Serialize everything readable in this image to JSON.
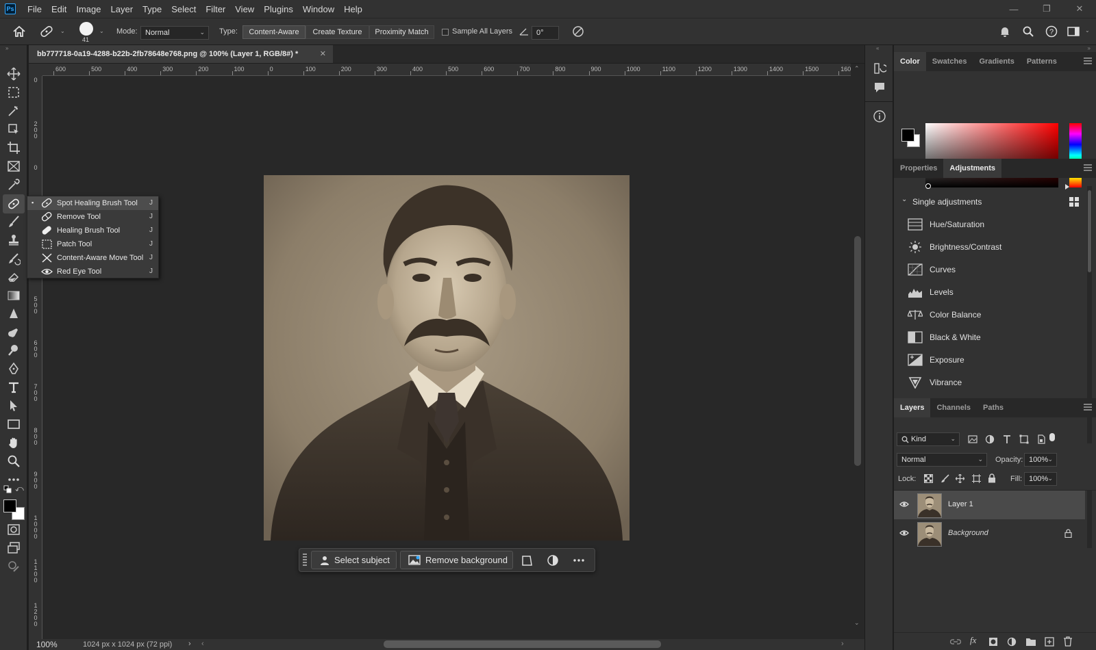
{
  "app": {
    "logo": "Ps"
  },
  "menu": [
    "File",
    "Edit",
    "Image",
    "Layer",
    "Type",
    "Select",
    "Filter",
    "View",
    "Plugins",
    "Window",
    "Help"
  ],
  "window_controls": [
    "—",
    "❐",
    "✕"
  ],
  "options": {
    "brush_size": "41",
    "mode_label": "Mode:",
    "mode_value": "Normal",
    "type_label": "Type:",
    "type_buttons": [
      "Content-Aware",
      "Create Texture",
      "Proximity Match"
    ],
    "sample_all_layers": "Sample All Layers",
    "angle_value": "0°"
  },
  "document": {
    "tab_title": "bb777718-0a19-4288-b22b-2fb78648e768.png @ 100% (Layer 1, RGB/8#) *",
    "zoom": "100%",
    "dimensions": "1024 px x 1024 px (72 ppi)"
  },
  "ruler": {
    "h_labels": [
      "600",
      "500",
      "400",
      "300",
      "200",
      "100",
      "0",
      "100",
      "200",
      "300",
      "400",
      "500",
      "600",
      "700",
      "800",
      "900",
      "1000",
      "1100",
      "1200",
      "1300",
      "1400",
      "1500",
      "1600"
    ],
    "v_labels": [
      "0",
      "2 0 0",
      "0",
      "3 0 0",
      "4 0 0",
      "5 0 0",
      "6 0 0",
      "7 0 0",
      "8 0 0",
      "9 0 0",
      "1 0 0 0",
      "1 1 0 0",
      "1 2 0 0"
    ]
  },
  "flyout": {
    "items": [
      {
        "label": "Spot Healing Brush Tool",
        "shortcut": "J",
        "icon": "spot-healing-icon"
      },
      {
        "label": "Remove Tool",
        "shortcut": "J",
        "icon": "remove-tool-icon"
      },
      {
        "label": "Healing Brush Tool",
        "shortcut": "J",
        "icon": "healing-brush-icon"
      },
      {
        "label": "Patch Tool",
        "shortcut": "J",
        "icon": "patch-tool-icon"
      },
      {
        "label": "Content-Aware Move Tool",
        "shortcut": "J",
        "icon": "content-aware-move-icon"
      },
      {
        "label": "Red Eye Tool",
        "shortcut": "J",
        "icon": "red-eye-icon"
      }
    ]
  },
  "context_bar": {
    "select_subject": "Select subject",
    "remove_background": "Remove background"
  },
  "color_panel": {
    "tabs": [
      "Color",
      "Swatches",
      "Gradients",
      "Patterns"
    ],
    "hue": "#ff0000",
    "foreground": "#000000",
    "background": "#ffffff"
  },
  "adjustments_panel": {
    "tabs": [
      "Properties",
      "Adjustments"
    ],
    "section": "Single adjustments",
    "items": [
      "Hue/Saturation",
      "Brightness/Contrast",
      "Curves",
      "Levels",
      "Color Balance",
      "Black & White",
      "Exposure",
      "Vibrance"
    ]
  },
  "layers_panel": {
    "tabs": [
      "Layers",
      "Channels",
      "Paths"
    ],
    "filter_kind": "Kind",
    "blend_mode": "Normal",
    "opacity_label": "Opacity:",
    "opacity_value": "100%",
    "lock_label": "Lock:",
    "fill_label": "Fill:",
    "fill_value": "100%",
    "layers": [
      {
        "name": "Layer 1",
        "selected": true
      },
      {
        "name": "Background",
        "locked": true
      }
    ]
  }
}
